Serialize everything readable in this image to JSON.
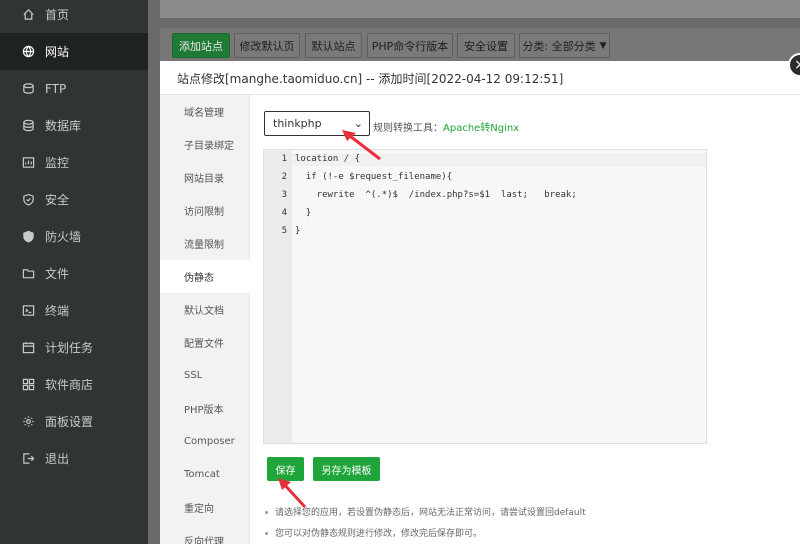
{
  "sidebar": {
    "items": [
      {
        "label": "首页",
        "icon": "home-icon",
        "active": false
      },
      {
        "label": "网站",
        "icon": "globe-icon",
        "active": true
      },
      {
        "label": "FTP",
        "icon": "ftp-icon",
        "active": false
      },
      {
        "label": "数据库",
        "icon": "database-icon",
        "active": false
      },
      {
        "label": "监控",
        "icon": "monitor-icon",
        "active": false
      },
      {
        "label": "安全",
        "icon": "shield-icon",
        "active": false
      },
      {
        "label": "防火墙",
        "icon": "firewall-icon",
        "active": false
      },
      {
        "label": "文件",
        "icon": "folder-icon",
        "active": false
      },
      {
        "label": "终端",
        "icon": "terminal-icon",
        "active": false
      },
      {
        "label": "计划任务",
        "icon": "calendar-icon",
        "active": false
      },
      {
        "label": "软件商店",
        "icon": "grid-icon",
        "active": false
      },
      {
        "label": "面板设置",
        "icon": "gear-icon",
        "active": false
      },
      {
        "label": "退出",
        "icon": "logout-icon",
        "active": false
      }
    ]
  },
  "toolbar": {
    "add_site": "添加站点",
    "modify_default_page": "修改默认页",
    "default_site": "默认站点",
    "php_cli_version": "PHP命令行版本",
    "security_settings": "安全设置",
    "category": "分类: 全部分类"
  },
  "dialog": {
    "title": "站点修改[manghe.taomiduo.cn] -- 添加时间[2022-04-12 09:12:51]",
    "close_symbol": "×",
    "tabs": [
      "域名管理",
      "子目录绑定",
      "网站目录",
      "访问限制",
      "流量限制",
      "伪静态",
      "默认文档",
      "配置文件",
      "SSL",
      "PHP版本",
      "Composer",
      "Tomcat",
      "重定向",
      "反向代理"
    ],
    "active_tab": "伪静态",
    "rewrite_select": "thinkphp",
    "rule_tool_label": "规则转换工具：",
    "rule_tool_link": "Apache转Nginx",
    "code_lines": [
      {
        "num": "1",
        "text": "location / {"
      },
      {
        "num": "2",
        "text": "  if (!-e $request_filename){"
      },
      {
        "num": "3",
        "text": "    rewrite  ^(.*)$  /index.php?s=$1  last;   break;"
      },
      {
        "num": "4",
        "text": "  }"
      },
      {
        "num": "5",
        "text": "}"
      }
    ],
    "save_button": "保存",
    "save_as_template_button": "另存为模板",
    "notes": [
      "请选择您的应用，若设置伪静态后，网站无法正常访问，请尝试设置回default",
      "您可以对伪静态规则进行修改，修改完后保存即可。"
    ]
  },
  "colors": {
    "accent_green": "#20a53a",
    "annotation_red": "#e8303a",
    "sidebar_bg": "#313532"
  }
}
